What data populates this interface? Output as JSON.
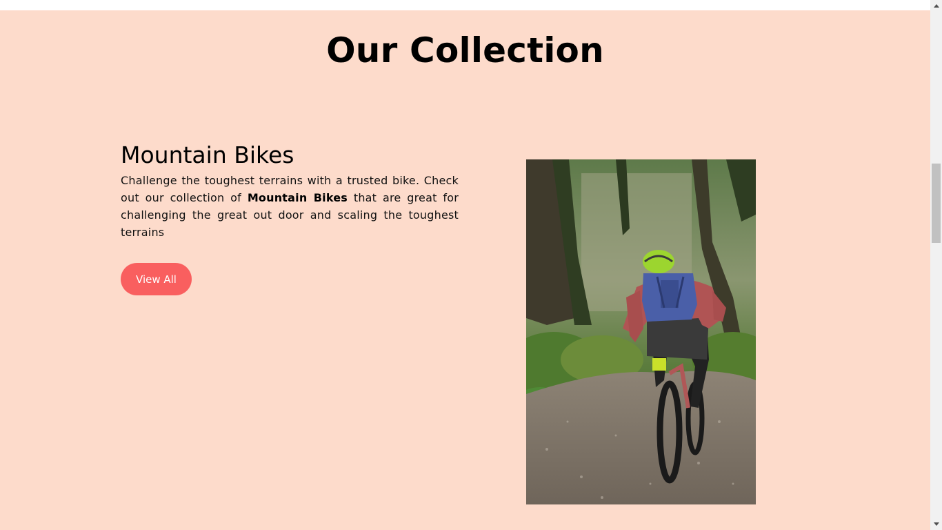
{
  "collection": {
    "title": "Our Collection"
  },
  "product": {
    "name": "Mountain Bikes",
    "description_before": "Challenge the toughest terrains with a trusted bike. Check out our collection of ",
    "description_bold": "Mountain Bikes",
    "description_after": " that are great for challenging the great out door and scaling the toughest terrains",
    "button_label": "View All",
    "image_alt": "Mountain biker riding on a forest trail"
  },
  "colors": {
    "section_background": "#fddbcb",
    "button": "#f95f5f",
    "button_text": "#ffffff",
    "title_text": "#000000"
  },
  "icons": {
    "scroll_up": "triangle-up-icon",
    "scroll_down": "triangle-down-icon"
  }
}
